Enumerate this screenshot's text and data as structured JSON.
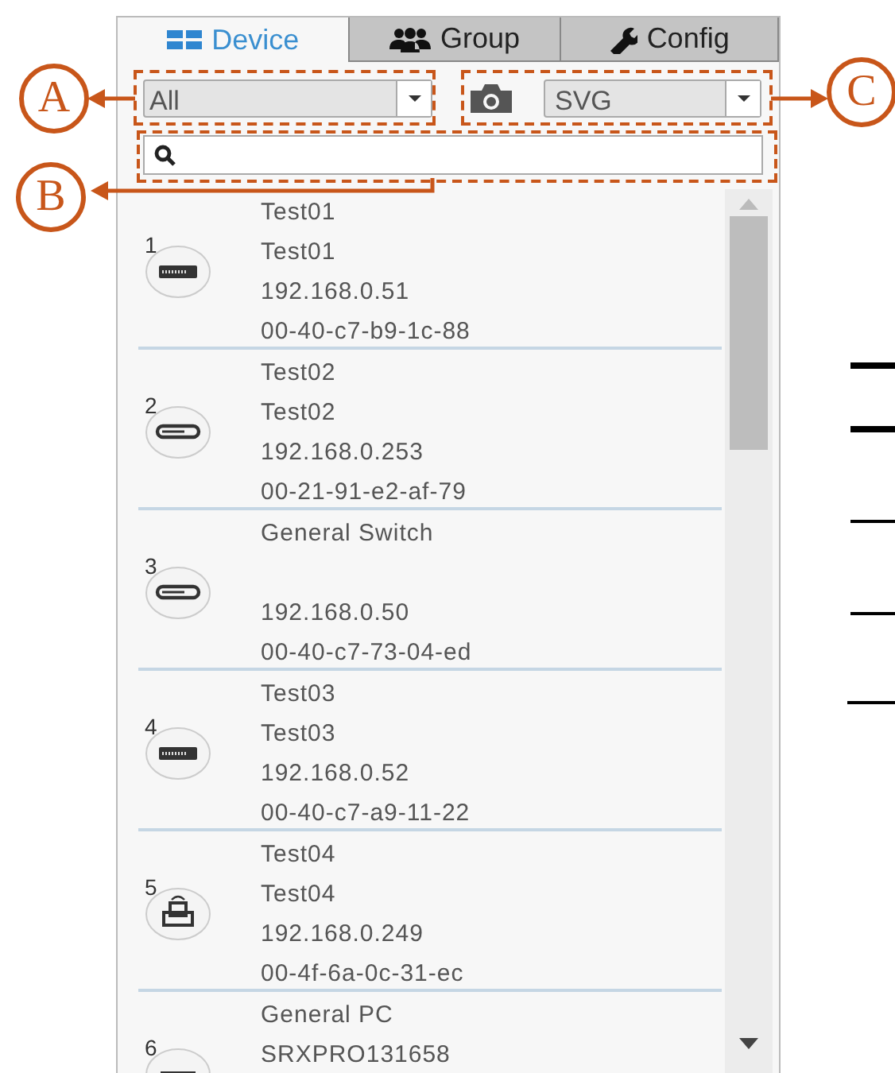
{
  "tabs": [
    {
      "label": "Device",
      "kind": "grid",
      "selected": true
    },
    {
      "label": "Group",
      "kind": "people",
      "selected": false
    },
    {
      "label": "Config",
      "kind": "wrench",
      "selected": false
    }
  ],
  "filter": {
    "value": "All"
  },
  "export_format": {
    "value": "SVG"
  },
  "devices": [
    {
      "number": "1",
      "kind": "rack-switch",
      "name": "Test01",
      "alias": "Test01",
      "ip": "192.168.0.51",
      "mac": "00-40-c7-b9-1c-88"
    },
    {
      "number": "2",
      "kind": "slim-switch",
      "name": "Test02",
      "alias": "Test02",
      "ip": "192.168.0.253",
      "mac": "00-21-91-e2-af-79"
    },
    {
      "number": "3",
      "kind": "slim-switch",
      "name": "General Switch",
      "ip": "192.168.0.50",
      "mac": "00-40-c7-73-04-ed"
    },
    {
      "number": "4",
      "kind": "rack-switch",
      "name": "Test03",
      "alias": "Test03",
      "ip": "192.168.0.52",
      "mac": "00-40-c7-a9-11-22"
    },
    {
      "number": "5",
      "kind": "camera",
      "name": "Test04",
      "alias": "Test04",
      "ip": "192.168.0.249",
      "mac": "00-4f-6a-0c-31-ec"
    },
    {
      "number": "6",
      "kind": "pc",
      "name": "General PC",
      "alias": "SRXPRO131658"
    }
  ],
  "callouts": [
    {
      "label": "A"
    },
    {
      "label": "B"
    },
    {
      "label": "C"
    }
  ]
}
